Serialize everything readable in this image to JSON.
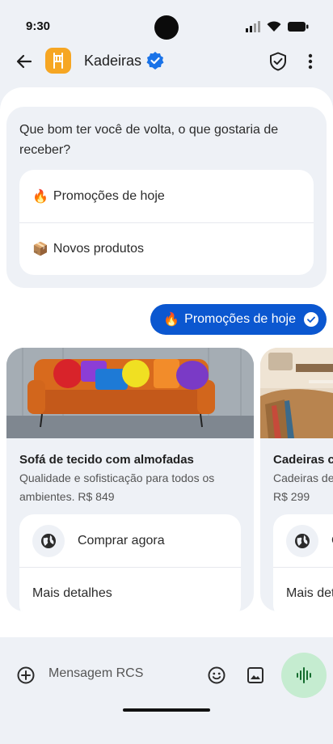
{
  "status_bar": {
    "time": "9:30"
  },
  "header": {
    "back_icon": "arrow-left-icon",
    "brand_name": "Kadeiras",
    "brand_color": "#f6a623",
    "verified_color": "#1a73e8"
  },
  "bot_message": {
    "text": "Que bom ter você de volta, o que gostaria de receber?",
    "options": [
      {
        "emoji": "🔥",
        "label": "Promoções de hoje"
      },
      {
        "emoji": "📦",
        "label": "Novos produtos"
      }
    ]
  },
  "user_message": {
    "emoji": "🔥",
    "text": "Promoções de hoje",
    "bubble_color": "#0b57d0"
  },
  "carousel": [
    {
      "title": "Sofá de tecido com almofadas",
      "description": "Qualidade e sofisticação para todos os ambientes. R$ 849",
      "buy_label": "Comprar agora",
      "details_label": "Mais detalhes"
    },
    {
      "title": "Cadeiras c",
      "description": "Cadeiras de",
      "price": "R$ 299",
      "buy_label": "C",
      "details_label": "Mais det"
    }
  ],
  "composer": {
    "placeholder": "Mensagem RCS",
    "voice_button_color": "#c5ecd0"
  }
}
